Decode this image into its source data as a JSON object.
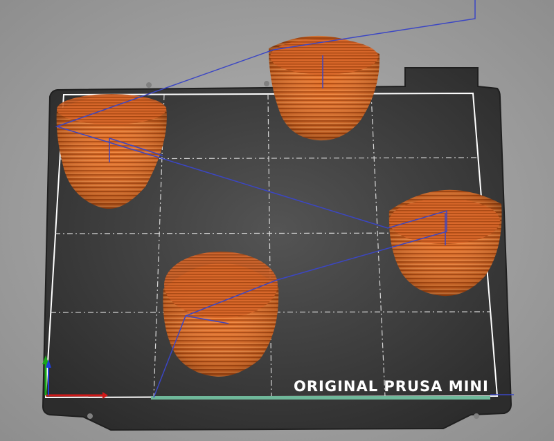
{
  "app": {
    "view": "3D G-code preview"
  },
  "bed": {
    "label": "ORIGINAL PRUSA MINI",
    "grid_columns": 4,
    "grid_rows": 4
  },
  "objects": [
    {
      "name": "vase-top-center"
    },
    {
      "name": "vase-upper-left"
    },
    {
      "name": "vase-right"
    },
    {
      "name": "vase-bottom-center"
    }
  ],
  "colors": {
    "background": "#9a9a9a",
    "bed_plate": "#3a3a3a",
    "bed_outline": "#ffffff",
    "grid": "#d8d8d8",
    "filament": "#e0702a",
    "filament_dark": "#b44d12",
    "travel_move": "#3b46c4",
    "axis_x": "#d01818",
    "axis_y": "#1aa61a",
    "axis_z": "#1f3fd8",
    "wipe_bar": "#6fb89a"
  }
}
